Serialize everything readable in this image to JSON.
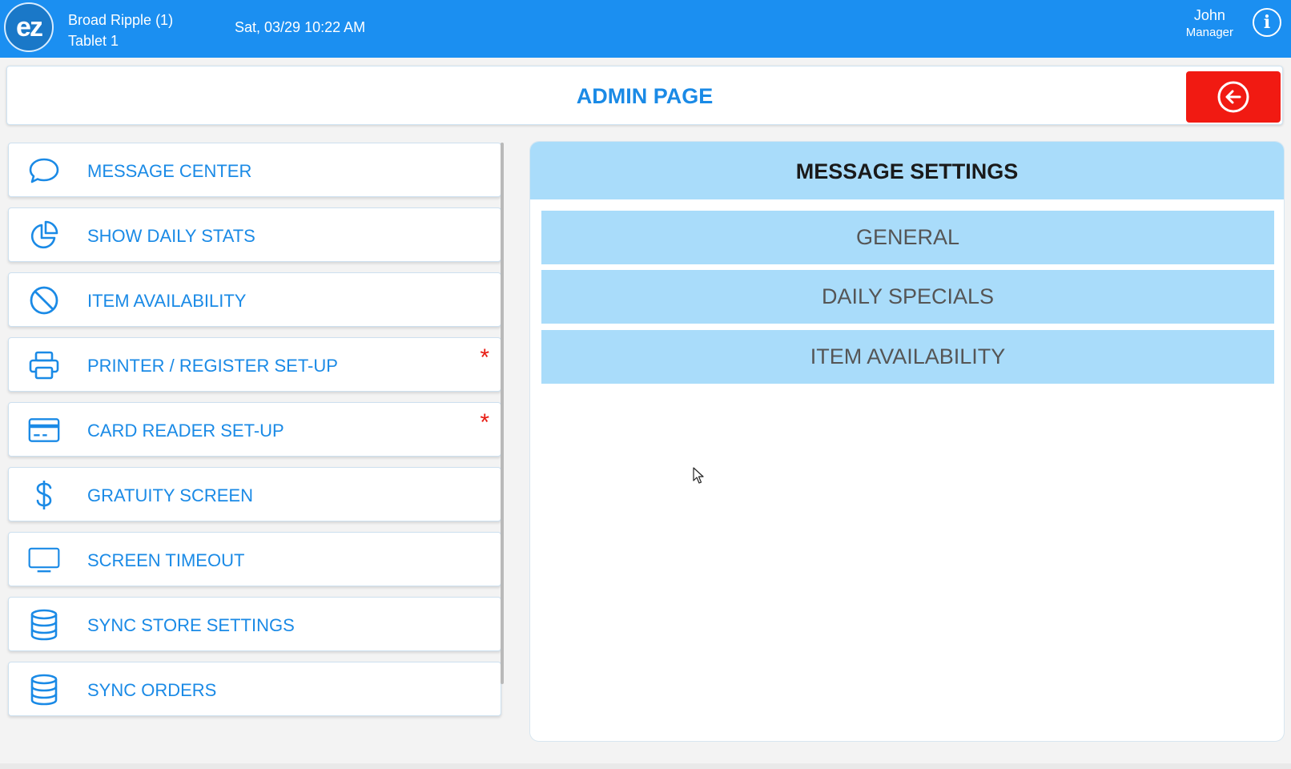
{
  "topbar": {
    "logo_text": "ez",
    "location": "Broad Ripple (1)",
    "device": "Tablet 1",
    "datetime": "Sat, 03/29 10:22 AM",
    "user_name": "John",
    "user_role": "Manager",
    "info_icon": "info-icon",
    "bar_color": "#1b8ff1"
  },
  "header": {
    "title": "ADMIN PAGE",
    "back_icon": "arrow-left-circle-icon",
    "back_color": "#f11a12"
  },
  "menu": {
    "items": [
      {
        "label": "MESSAGE CENTER",
        "icon": "chat-bubble-icon",
        "required": false
      },
      {
        "label": "SHOW DAILY STATS",
        "icon": "pie-chart-icon",
        "required": false
      },
      {
        "label": "ITEM AVAILABILITY",
        "icon": "ban-icon",
        "required": false
      },
      {
        "label": "PRINTER / REGISTER SET-UP",
        "icon": "printer-icon",
        "required": true
      },
      {
        "label": "CARD READER SET-UP",
        "icon": "credit-card-icon",
        "required": true
      },
      {
        "label": "GRATUITY SCREEN",
        "icon": "dollar-icon",
        "required": false
      },
      {
        "label": "SCREEN TIMEOUT",
        "icon": "monitor-icon",
        "required": false
      },
      {
        "label": "SYNC STORE SETTINGS",
        "icon": "database-icon",
        "required": false
      },
      {
        "label": "SYNC ORDERS",
        "icon": "database-icon",
        "required": false
      }
    ],
    "required_marker": "*",
    "accent_color": "#1a8ae6",
    "marker_color": "#e81b12"
  },
  "panel": {
    "title": "MESSAGE SETTINGS",
    "options": [
      "GENERAL",
      "DAILY SPECIALS",
      "ITEM AVAILABILITY"
    ],
    "option_color": "#a9dcfa"
  }
}
